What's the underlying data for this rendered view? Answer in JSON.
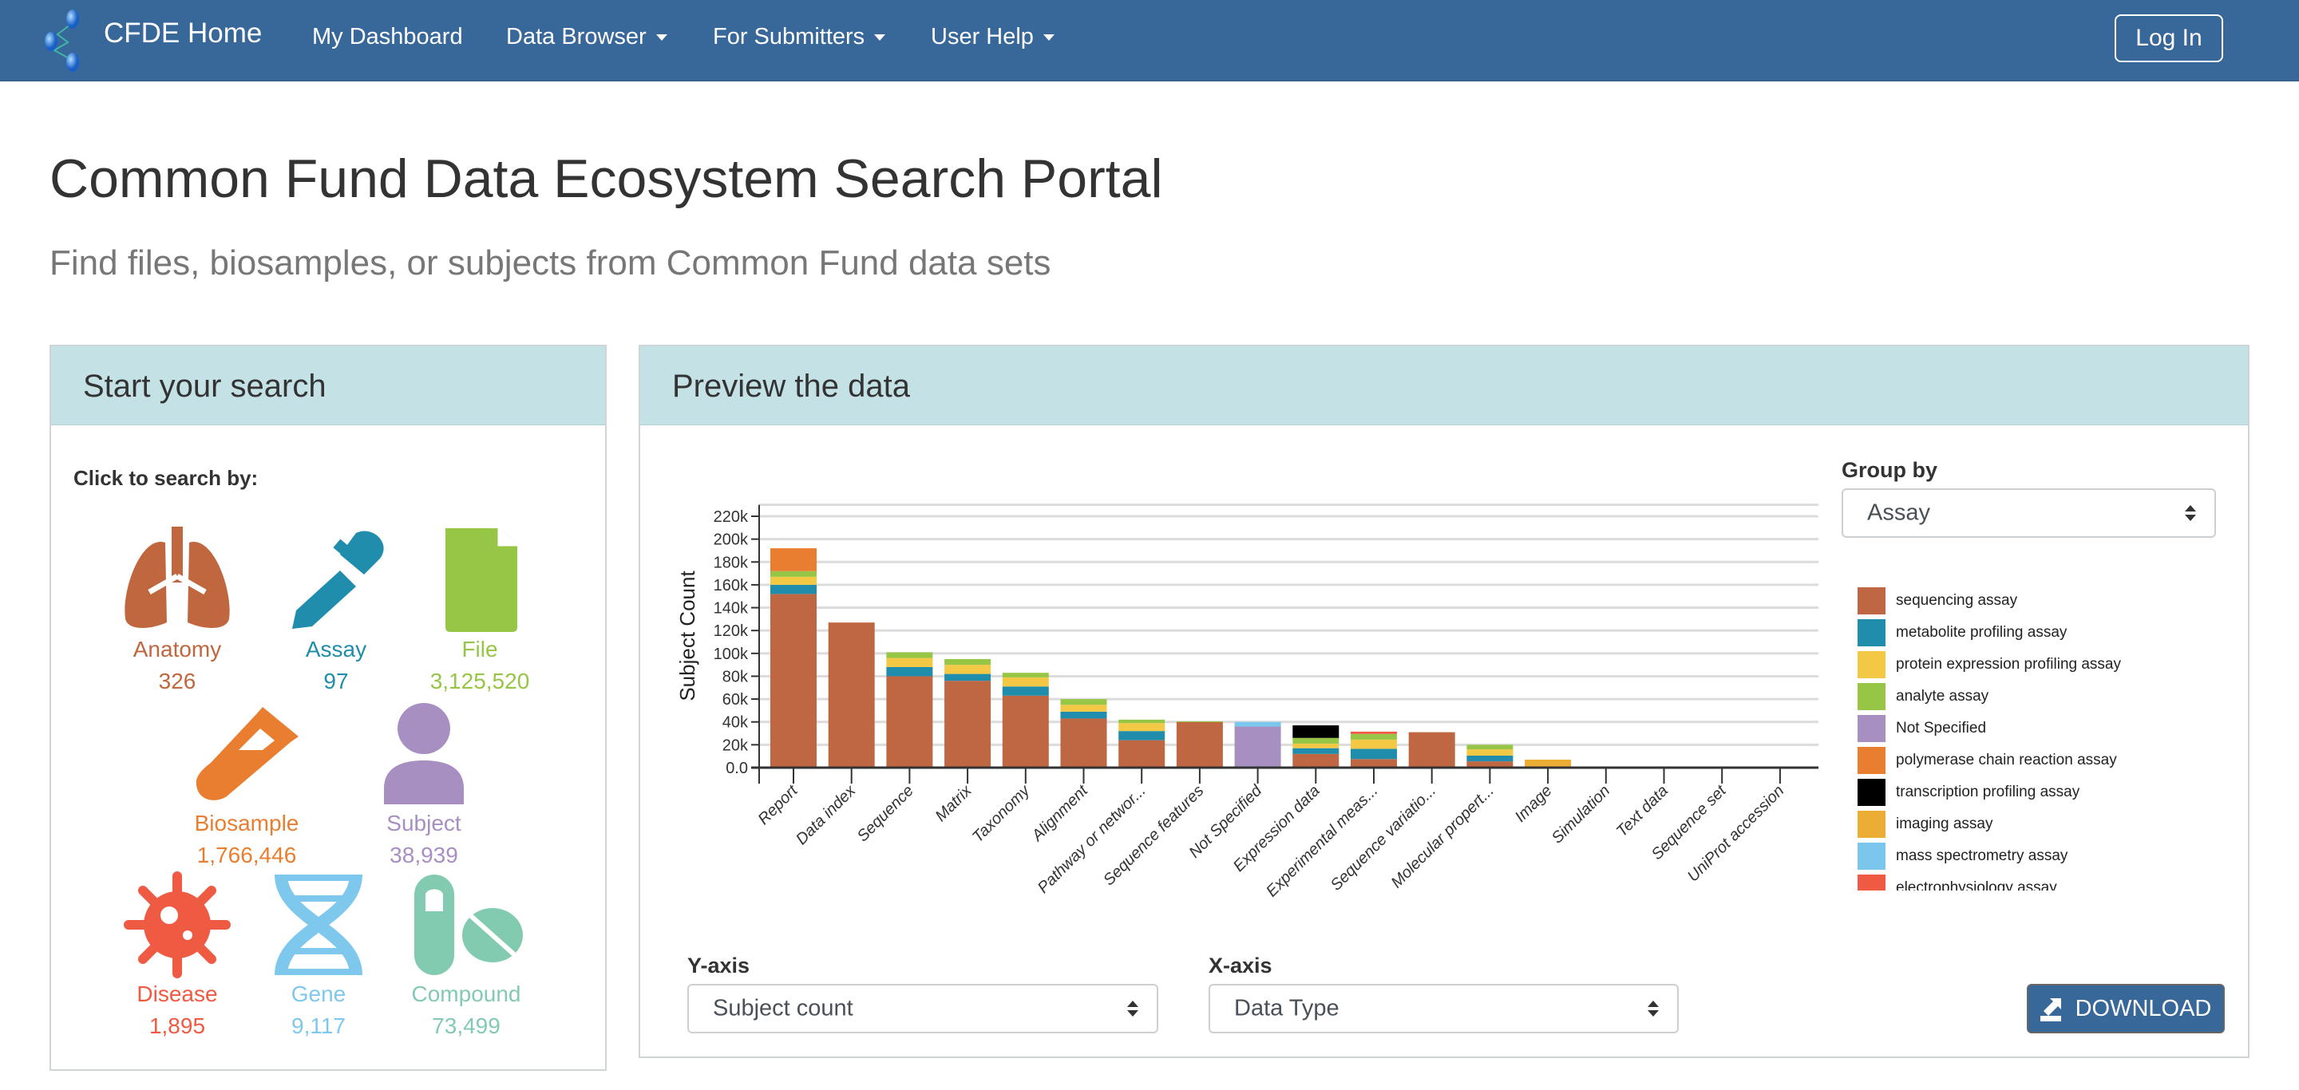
{
  "navbar": {
    "brand": "CFDE Home",
    "items": [
      {
        "label": "My Dashboard",
        "dropdown": false
      },
      {
        "label": "Data Browser",
        "dropdown": true
      },
      {
        "label": "For Submitters",
        "dropdown": true
      },
      {
        "label": "User Help",
        "dropdown": true
      }
    ],
    "login_label": "Log In",
    "color": "#38679a"
  },
  "header": {
    "title": "Common Fund Data Ecosystem Search Portal",
    "subtitle": "Find files, biosamples, or subjects from Common Fund data sets"
  },
  "search_panel": {
    "title": "Start your search",
    "prompt": "Click to search by:",
    "categories": [
      {
        "label": "Anatomy",
        "count": "326",
        "icon": "lungs-icon",
        "color": "#c0673f"
      },
      {
        "label": "Assay",
        "count": "97",
        "icon": "dropper-icon",
        "color": "#1f8dab"
      },
      {
        "label": "File",
        "count": "3,125,520",
        "icon": "file-icon",
        "color": "#97c647"
      },
      {
        "label": "Biosample",
        "count": "1,766,446",
        "icon": "test-tube-icon",
        "color": "#ea7e30"
      },
      {
        "label": "Subject",
        "count": "38,939",
        "icon": "person-icon",
        "color": "#a88fc2"
      },
      {
        "label": "Disease",
        "count": "1,895",
        "icon": "virus-icon",
        "color": "#ef5a43"
      },
      {
        "label": "Gene",
        "count": "9,117",
        "icon": "dna-icon",
        "color": "#7fc8ed"
      },
      {
        "label": "Compound",
        "count": "73,499",
        "icon": "pills-icon",
        "color": "#83cbb0"
      }
    ]
  },
  "preview_panel": {
    "title": "Preview the data",
    "group_by_label": "Group by",
    "group_by_value": "Assay",
    "y_axis_label": "Y-axis",
    "y_axis_value": "Subject count",
    "x_axis_label": "X-axis",
    "x_axis_value": "Data Type",
    "download_label": "DOWNLOAD"
  },
  "chart_data": {
    "type": "bar",
    "stacked": true,
    "ylabel": "Subject Count",
    "xlabel": "",
    "ylim": [
      0,
      230000
    ],
    "yticks": [
      0,
      20000,
      40000,
      60000,
      80000,
      100000,
      120000,
      140000,
      160000,
      180000,
      200000,
      220000
    ],
    "ytick_labels": [
      "0.0",
      "20k",
      "40k",
      "60k",
      "80k",
      "100k",
      "120k",
      "140k",
      "160k",
      "180k",
      "200k",
      "220k"
    ],
    "grid": true,
    "legend_position": "right",
    "categories": [
      "Report",
      "Data index",
      "Sequence",
      "Matrix",
      "Taxonomy",
      "Alignment",
      "Pathway or networ...",
      "Sequence features",
      "Not Specified",
      "Expression data",
      "Experimental meas...",
      "Sequence variatio...",
      "Molecular propert...",
      "Image",
      "Simulation",
      "Text data",
      "Sequence set",
      "UniProt accession"
    ],
    "series": [
      {
        "name": "sequencing assay",
        "color": "#bf6642",
        "values": [
          152000,
          127000,
          80000,
          76000,
          63000,
          43000,
          24000,
          40000,
          0,
          12000,
          7500,
          31000,
          5500,
          1000,
          0,
          0,
          0,
          0
        ]
      },
      {
        "name": "metabolite profiling assay",
        "color": "#1f8dab",
        "values": [
          8000,
          0,
          8000,
          6000,
          8000,
          6000,
          8000,
          0,
          0,
          5000,
          9000,
          0,
          5000,
          0,
          0,
          0,
          0,
          0
        ]
      },
      {
        "name": "protein expression profiling assay",
        "color": "#f2c844",
        "values": [
          7000,
          0,
          8000,
          8000,
          8000,
          6000,
          7000,
          0,
          0,
          4000,
          8000,
          0,
          5500,
          0,
          0,
          0,
          0,
          0
        ]
      },
      {
        "name": "analyte assay",
        "color": "#97c647",
        "values": [
          5000,
          0,
          5000,
          5000,
          4000,
          5000,
          3000,
          500,
          0,
          5000,
          5000,
          0,
          4000,
          0,
          0,
          0,
          0,
          0
        ]
      },
      {
        "name": "Not Specified",
        "color": "#a88fc2",
        "values": [
          0,
          0,
          0,
          0,
          0,
          0,
          0,
          0,
          36000,
          0,
          0,
          0,
          0,
          0,
          1000,
          0,
          0,
          0
        ]
      },
      {
        "name": "polymerase chain reaction assay",
        "color": "#ea7e30",
        "values": [
          20000,
          0,
          0,
          0,
          0,
          0,
          0,
          0,
          0,
          0,
          0,
          0,
          0,
          0,
          0,
          0,
          0,
          0
        ]
      },
      {
        "name": "transcription profiling assay",
        "color": "#000000",
        "values": [
          0,
          0,
          0,
          0,
          0,
          0,
          0,
          0,
          0,
          11000,
          0,
          0,
          0,
          0,
          0,
          0,
          0,
          0
        ]
      },
      {
        "name": "imaging assay",
        "color": "#ecad34",
        "values": [
          0,
          0,
          0,
          0,
          0,
          0,
          0,
          0,
          0,
          0,
          0,
          0,
          0,
          6000,
          0,
          0,
          0,
          0
        ]
      },
      {
        "name": "mass spectrometry assay",
        "color": "#7bc6ec",
        "values": [
          0,
          0,
          0,
          0,
          0,
          0,
          0,
          0,
          4000,
          0,
          0,
          0,
          0,
          0,
          0,
          0,
          0,
          0
        ]
      },
      {
        "name": "electrophysiology assay",
        "color": "#ef5a43",
        "values": [
          0,
          0,
          0,
          0,
          0,
          0,
          0,
          0,
          0,
          0,
          2000,
          0,
          0,
          0,
          0,
          0,
          0,
          0
        ]
      }
    ]
  }
}
